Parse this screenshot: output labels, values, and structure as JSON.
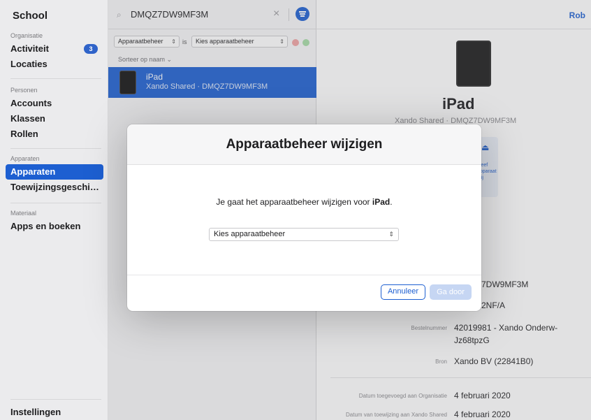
{
  "sidebar": {
    "brand": "School",
    "sections": [
      {
        "title": "Organisatie",
        "items": [
          {
            "label": "Activiteit",
            "badge": "3"
          },
          {
            "label": "Locaties"
          }
        ]
      },
      {
        "title": "Personen",
        "items": [
          {
            "label": "Accounts"
          },
          {
            "label": "Klassen"
          },
          {
            "label": "Rollen"
          }
        ]
      },
      {
        "title": "Apparaten",
        "items": [
          {
            "label": "Apparaten",
            "active": true
          },
          {
            "label": "Toewijzingsgeschied..."
          }
        ]
      },
      {
        "title": "Materiaal",
        "items": [
          {
            "label": "Apps en boeken"
          }
        ]
      }
    ],
    "settings": "Instellingen"
  },
  "list": {
    "search_value": "DMQZ7DW9MF3M",
    "filter": {
      "field": "Apparaatbeheer",
      "operator": "is",
      "value": "Kies apparaatbeheer"
    },
    "sort": "Sorteer op naam ⌄",
    "rows": [
      {
        "name": "iPad",
        "subtitle": "Xando Shared · DMQZ7DW9MF3M"
      }
    ]
  },
  "detail": {
    "user": "Rob",
    "device_name": "iPad",
    "device_subtitle": "Xando Shared · DMQZ7DW9MF3M",
    "release_label": "Geef apparaat vrij",
    "serial_partial": "7DW9MF3M",
    "model_partial": "2NF/A",
    "order_label": "Bestelnummer",
    "order_value": "42019981 - Xando Onderw-Jz68tpzG",
    "source_label": "Bron",
    "source_value": "Xando BV (22841B0)",
    "added_label": "Datum toegevoegd aan Organisatie",
    "added_value": "4 februari 2020",
    "assigned_label": "Datum van toewijzing aan Xando Shared",
    "assigned_value": "4 februari 2020"
  },
  "modal": {
    "title": "Apparaatbeheer wijzigen",
    "message_prefix": "Je gaat het apparaatbeheer wijzigen voor ",
    "message_device": "iPad",
    "message_suffix": ".",
    "select_value": "Kies apparaatbeheer",
    "cancel": "Annuleer",
    "confirm": "Ga door"
  },
  "colors": {
    "accent": "#1d5fd1",
    "disabled": "#c6d6f3"
  },
  "icons": [
    "apple-icon",
    "search-icon",
    "close-icon",
    "filter-icon",
    "chevron-icon",
    "eject-icon"
  ]
}
